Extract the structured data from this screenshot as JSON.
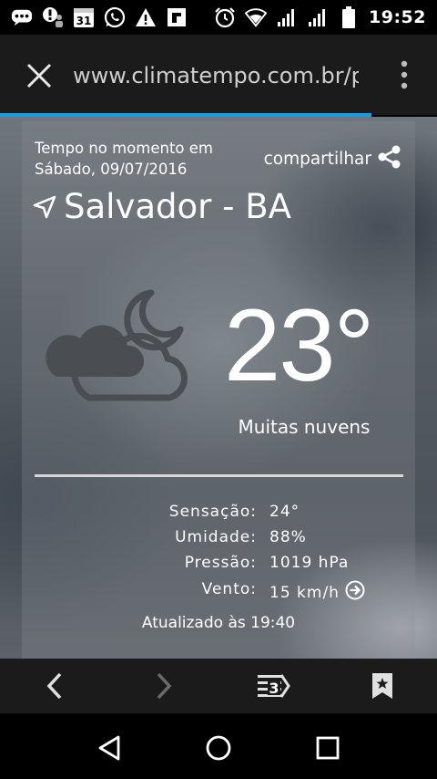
{
  "status_bar": {
    "time": "19:52",
    "calendar_day": "31",
    "icons": [
      "chat-icon",
      "alert-person-icon",
      "calendar-icon",
      "whatsapp-icon",
      "warning-icon",
      "flipboard-icon",
      "alarm-icon",
      "wifi-icon",
      "signal-icon",
      "signal-icon",
      "battery-icon"
    ]
  },
  "browser": {
    "url": "www.climatempo.com.br/p",
    "tab_count": "3",
    "progress_fraction": 0.85,
    "progress_color": "#1e9be0"
  },
  "weather": {
    "now_label": "Tempo no momento em",
    "date": "Sábado, 09/07/2016",
    "share_label": "compartilhar",
    "city": "Salvador - BA",
    "temperature": "23°",
    "condition": "Muitas nuvens",
    "icon": "cloud-moon-icon",
    "details": [
      {
        "label": "Sensação:",
        "value": "24°"
      },
      {
        "label": "Umidade:",
        "value": "88%"
      },
      {
        "label": "Pressão:",
        "value": "1019 hPa"
      },
      {
        "label": "Vento:",
        "value": "15 km/h"
      }
    ],
    "updated": "Atualizado às 19:40"
  }
}
